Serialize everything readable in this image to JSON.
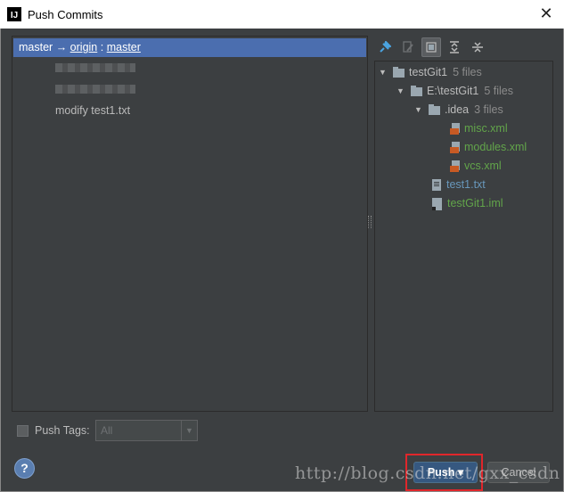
{
  "window": {
    "title": "Push Commits",
    "app_icon_letter": "IJ",
    "close_glyph": "✕"
  },
  "left": {
    "branch": {
      "local": "master",
      "arrow": "→",
      "remote": "origin",
      "separator": ":",
      "remote_branch": "master"
    },
    "commits": [
      "modify test1.txt"
    ]
  },
  "toolbar": {
    "icons": [
      "pin-icon",
      "edit-source-icon",
      "group-by-module-icon",
      "expand-all-icon",
      "collapse-all-icon"
    ]
  },
  "tree": {
    "root": {
      "name": "testGit1",
      "count": "5 files"
    },
    "module": {
      "name": "E:\\testGit1",
      "count": "5 files"
    },
    "idea": {
      "name": ".idea",
      "count": "3 files"
    },
    "files": [
      {
        "name": "misc.xml"
      },
      {
        "name": "modules.xml"
      },
      {
        "name": "vcs.xml"
      },
      {
        "name": "test1.txt"
      },
      {
        "name": "testGit1.iml"
      }
    ]
  },
  "push_tags": {
    "label": "Push Tags:",
    "select_value": "All"
  },
  "buttons": {
    "help": "?",
    "push": "Push",
    "push_arrow": "▾",
    "cancel": "Cancel"
  },
  "watermark": "http://blog.csdn.net/gxx_csdn",
  "colors": {
    "selection": "#4b6eaf",
    "panel_bg": "#3c3f41",
    "highlight_box": "#e0262b",
    "added_file": "#62a54a",
    "modified_file": "#6897bb"
  }
}
